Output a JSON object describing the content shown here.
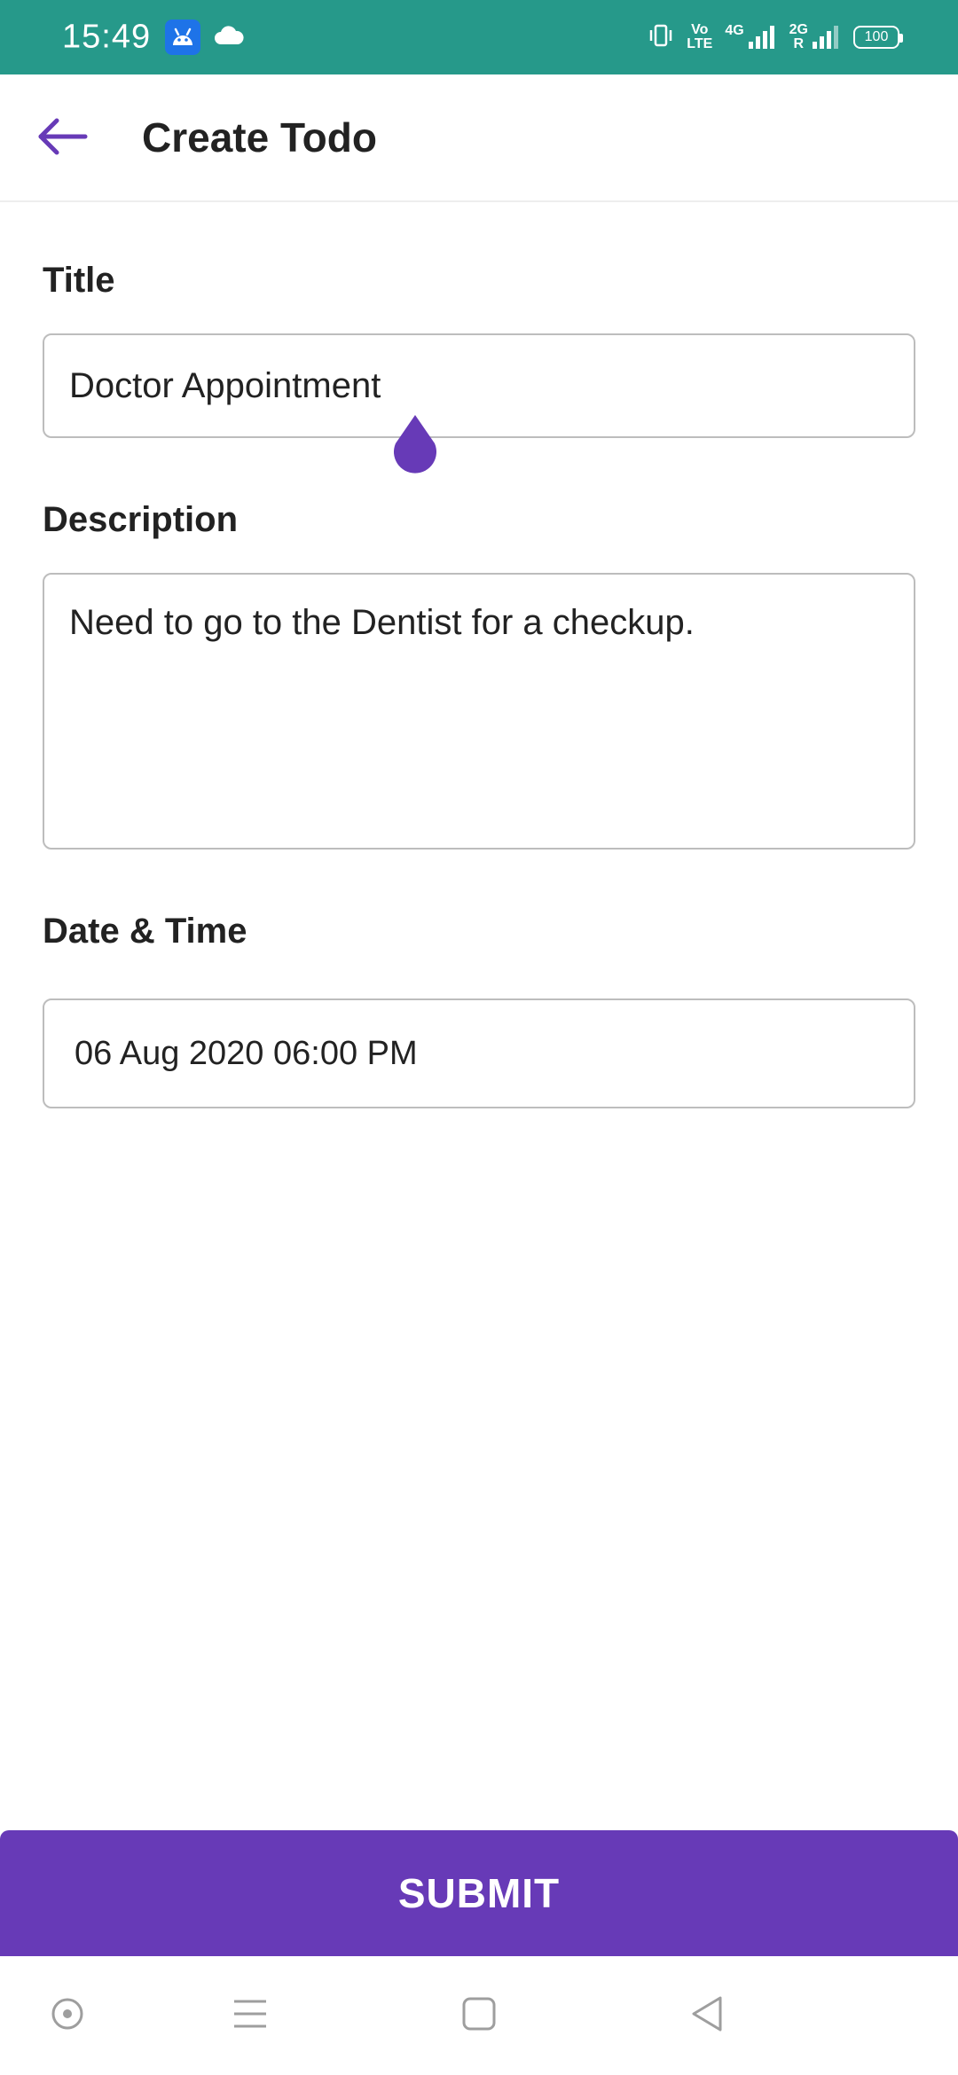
{
  "status_bar": {
    "time": "15:49",
    "left_icons": [
      "android-icon",
      "cloud-icon"
    ],
    "right_icons": [
      "vibrate-icon",
      "volte-icon",
      "signal-4g-icon",
      "signal-2g-icon",
      "battery-icon"
    ],
    "volte_label": "Vo\nLTE",
    "network_1_label": "4G",
    "network_2_label": "2G",
    "network_2_sub": "R",
    "battery_level": "100"
  },
  "header": {
    "title": "Create Todo",
    "back_icon": "arrow-back-icon"
  },
  "form": {
    "title_label": "Title",
    "title_value": "Doctor Appointment",
    "description_label": "Description",
    "description_value": "Need to go to the Dentist for a checkup.",
    "datetime_label": "Date & Time",
    "datetime_value": "06 Aug 2020 06:00 PM"
  },
  "actions": {
    "submit_label": "SUBMIT"
  },
  "nav_bar": {
    "icons": [
      "assistant-dot-icon",
      "menu-lines-icon",
      "home-square-icon",
      "back-triangle-icon"
    ]
  },
  "colors": {
    "status_bar": "#26998a",
    "accent": "#673ab7",
    "text": "#222222",
    "border": "#bdbdbd"
  }
}
